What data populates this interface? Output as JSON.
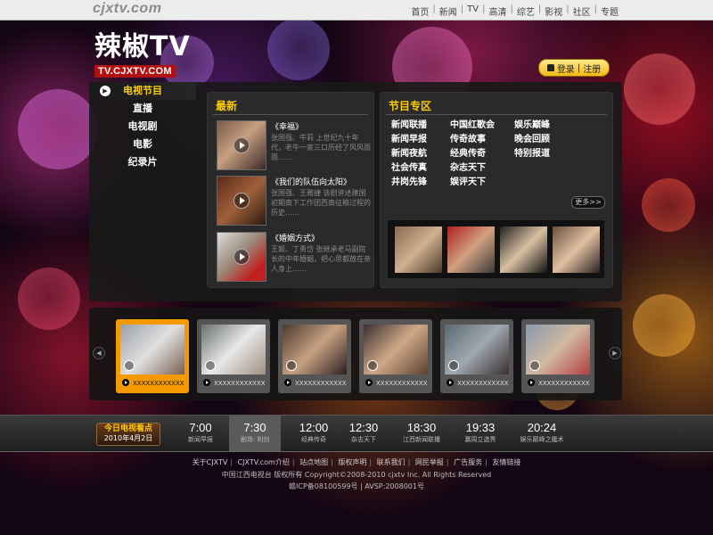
{
  "site": {
    "logo": "cjxtv.com"
  },
  "top_nav": [
    "首页",
    "新闻",
    "TV",
    "高清",
    "综艺",
    "影视",
    "社区",
    "专题"
  ],
  "brand": {
    "title": "辣椒TV",
    "subtitle": "TV.CJXTV.COM"
  },
  "login": {
    "login_label": "登录",
    "separator": "|",
    "register_label": "注册"
  },
  "sidebar": {
    "items": [
      "电视节目",
      "直播",
      "电视剧",
      "电影",
      "纪录片"
    ]
  },
  "latest": {
    "title": "最新",
    "items": [
      {
        "name": "《幸福》",
        "desc": "张国强、牛莉 上世纪九十年代，老牛一家三口历经了风风雨雨……"
      },
      {
        "name": "《我们的队伍向太阳》",
        "desc": "张国强、王雅捷 该剧讲述建国初期南下工作团西南征粮过程的历史……"
      },
      {
        "name": "《婚姻方式》",
        "desc": "王姬、丁勇岱 张继承老马副院长的中年婚姻，把心思都放在亲人身上……"
      }
    ]
  },
  "programs": {
    "title": "节目专区",
    "col1": [
      "新闻联播",
      "新闻早报",
      "新闻夜航",
      "社会传真",
      "井岗先锋"
    ],
    "col2": [
      "中国红歌会",
      "传奇故事",
      "经典传奇",
      "杂志天下",
      "娱评天下"
    ],
    "col3": [
      "娱乐巅峰",
      "晚会回顾",
      "特别报道"
    ],
    "more_label": "更多>>"
  },
  "carousel": {
    "items": [
      "XXXXXXXXXXXX",
      "XXXXXXXXXXXX",
      "XXXXXXXXXXXX",
      "XXXXXXXXXXXX",
      "XXXXXXXXXXXX",
      "XXXXXXXXXXXX"
    ]
  },
  "schedule": {
    "badge_title": "今日电视看点",
    "date": "2010年4月2日",
    "slots": [
      {
        "time": "7:00",
        "name": "新闻早报"
      },
      {
        "time": "7:30",
        "name": "剧场: 利剑"
      },
      {
        "time": "12:00",
        "name": "经典传奇"
      },
      {
        "time": "12:30",
        "name": "杂志天下"
      },
      {
        "time": "18:30",
        "name": "江西新闻联播"
      },
      {
        "time": "19:33",
        "name": "赢周立选秀"
      },
      {
        "time": "20:24",
        "name": "娱乐巅峰之魔术"
      }
    ]
  },
  "footer": {
    "links": [
      "关于CJXTV",
      "CJXTV.com介绍",
      "站点地图",
      "版权声明",
      "联系我们",
      "网民举报",
      "广告服务",
      "友情链接"
    ],
    "copyright": "中国江西电视台 版权所有 Copyright©2008-2010 cjxtv Inc. All Rights Reserved",
    "license": "赣ICP备08100599号 | AVSP:2008001号"
  },
  "colors": {
    "accent": "#ffcc00",
    "carousel_active": "#f29a00",
    "brand_red": "#b21010"
  }
}
